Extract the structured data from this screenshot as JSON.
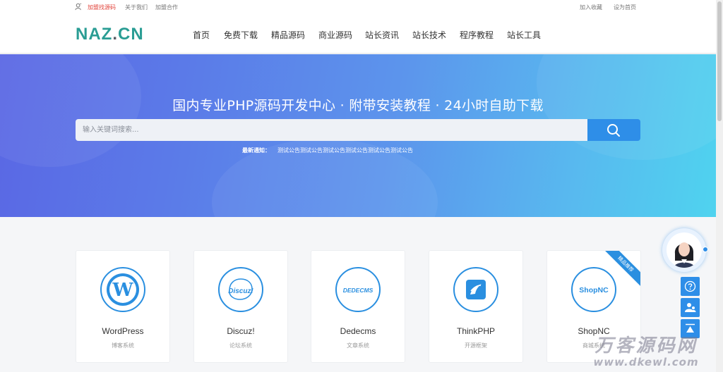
{
  "topbar": {
    "left_links": [
      "加盟找源码",
      "关于我们",
      "加盟合作"
    ],
    "right_links": [
      "加入收藏",
      "设为首页"
    ]
  },
  "header": {
    "logo_main": "NAZ",
    "logo_dot": ".",
    "logo_tld": "CN",
    "nav": [
      "首页",
      "免费下载",
      "精品源码",
      "商业源码",
      "站长资讯",
      "站长技术",
      "程序教程",
      "站长工具"
    ]
  },
  "banner": {
    "headline": "国内专业PHP源码开发中心 · 附带安装教程 · 24小时自助下载",
    "search_placeholder": "输入关键词搜索...",
    "notice_label": "最新通知：",
    "notice_text": "测试公告测试公告测试公告测试公告测试公告测试公告"
  },
  "cards": [
    {
      "name": "WordPress",
      "sub": "博客系统",
      "icon": "wordpress-logo"
    },
    {
      "name": "Discuz!",
      "sub": "论坛系统",
      "icon": "discuz-logo",
      "logo_text": "Discuz!"
    },
    {
      "name": "Dedecms",
      "sub": "文章系统",
      "icon": "dedecms-logo",
      "logo_text": "DEDECMS"
    },
    {
      "name": "ThinkPHP",
      "sub": "开源框架",
      "icon": "thinkphp-logo"
    },
    {
      "name": "ShopNC",
      "sub": "商城系统",
      "icon": "shopnc-logo",
      "logo_text": "ShopNC",
      "ribbon": "精品推荐"
    }
  ],
  "watermark": {
    "line1": "万客源码网",
    "line2": "www.dkewl.com"
  },
  "colors": {
    "accent": "#2e8ee8",
    "logo": "#2a9d94",
    "red_link": "#e2453c"
  }
}
